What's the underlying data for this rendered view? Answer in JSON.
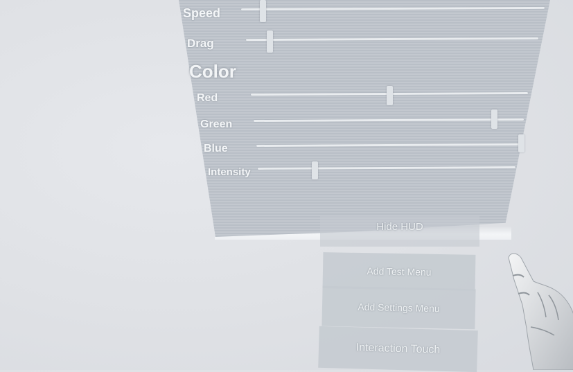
{
  "movement": {
    "speed": {
      "label": "Speed",
      "value": 0.07
    },
    "drag": {
      "label": "Drag",
      "value": 0.08
    }
  },
  "color": {
    "title": "Color",
    "red": {
      "label": "Red",
      "value": 0.5
    },
    "green": {
      "label": "Green",
      "value": 0.89
    },
    "blue": {
      "label": "Blue",
      "value": 1.0
    },
    "intensity": {
      "label": "Intensity",
      "value": 0.22
    }
  },
  "buttons": {
    "hide_hud": "Hide HUD",
    "add_test_menu": "Add Test Menu",
    "add_settings_menu": "Add Settings Menu",
    "interaction_mode": "Interaction  Touch"
  },
  "colors": {
    "panel": "#c0c5cc",
    "background": "#e0e2e6",
    "button": "#c4cad0"
  },
  "icons": {
    "hand": "vr-hand-pointer-icon"
  }
}
